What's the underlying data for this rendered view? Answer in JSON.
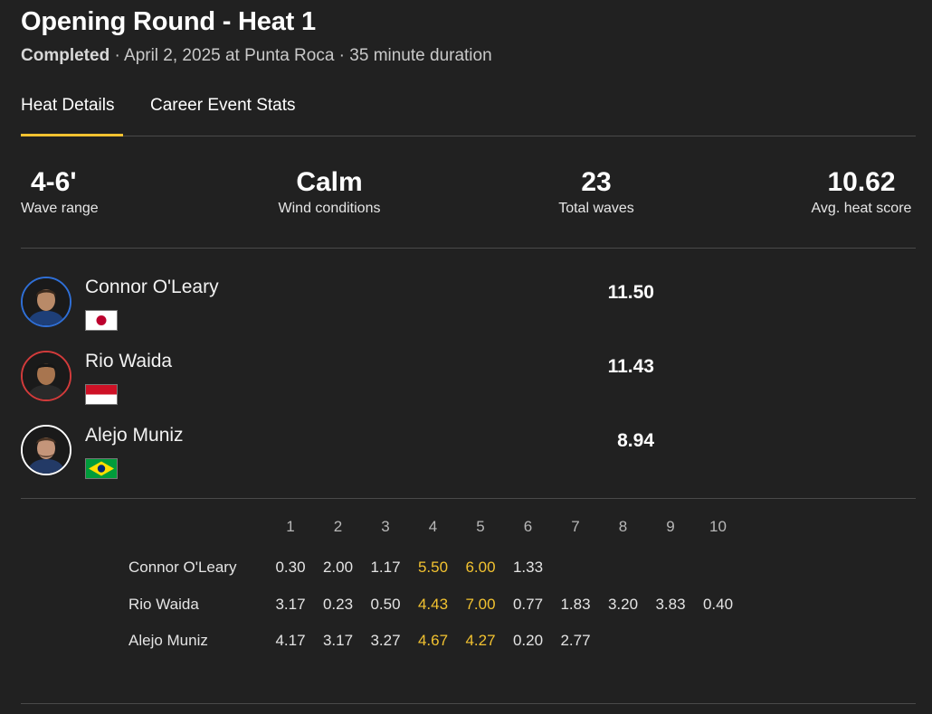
{
  "header": {
    "title": "Opening Round - Heat 1",
    "status": "Completed",
    "details": " · April 2, 2025 at Punta Roca · 35 minute duration"
  },
  "tabs": [
    {
      "label": "Heat Details",
      "active": true
    },
    {
      "label": "Career Event Stats",
      "active": false
    }
  ],
  "accent_color": "#f2c230",
  "stats": [
    {
      "value": "4-6'",
      "label": "Wave range"
    },
    {
      "value": "Calm",
      "label": "Wind conditions"
    },
    {
      "value": "23",
      "label": "Total waves"
    },
    {
      "value": "10.62",
      "label": "Avg. heat score"
    }
  ],
  "surfers": [
    {
      "name": "Connor O'Leary",
      "score": "11.50",
      "jersey_color": "#2f6fd6",
      "flag": "japan-flag"
    },
    {
      "name": "Rio Waida",
      "score": "11.43",
      "jersey_color": "#d23b3b",
      "flag": "indonesia-flag"
    },
    {
      "name": "Alejo Muniz",
      "score": "8.94",
      "jersey_color": "#ffffff",
      "flag": "brazil-flag"
    }
  ],
  "wave_table": {
    "columns": [
      "1",
      "2",
      "3",
      "4",
      "5",
      "6",
      "7",
      "8",
      "9",
      "10"
    ],
    "rows": [
      {
        "name": "Connor O'Leary",
        "scores": [
          "0.30",
          "2.00",
          "1.17",
          "5.50",
          "6.00",
          "1.33"
        ],
        "counting": [
          3,
          4
        ]
      },
      {
        "name": "Rio Waida",
        "scores": [
          "3.17",
          "0.23",
          "0.50",
          "4.43",
          "7.00",
          "0.77",
          "1.83",
          "3.20",
          "3.83",
          "0.40"
        ],
        "counting": [
          3,
          4
        ]
      },
      {
        "name": "Alejo Muniz",
        "scores": [
          "4.17",
          "3.17",
          "3.27",
          "4.67",
          "4.27",
          "0.20",
          "2.77"
        ],
        "counting": [
          3,
          4
        ]
      }
    ]
  }
}
